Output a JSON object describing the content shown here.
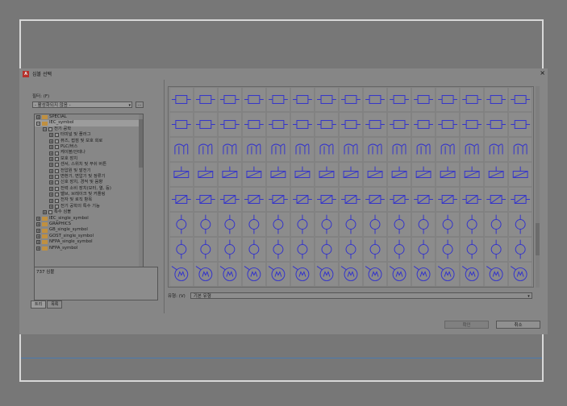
{
  "dialog": {
    "title": "심볼 선택",
    "close_glyph": "×",
    "app_icon_glyph": "A"
  },
  "filter": {
    "label": "필터: (F)",
    "value": "- 활성화되지 않음 -",
    "arrow": "▾",
    "more": "..."
  },
  "tree": {
    "items": [
      {
        "label": "SPECIAL",
        "depth": 0,
        "expander": "+",
        "kind": "folder"
      },
      {
        "label": "IEC_symbol",
        "depth": 0,
        "expander": "−",
        "kind": "folder",
        "selected": true
      },
      {
        "label": "전기 공학",
        "depth": 1,
        "expander": "−",
        "kind": "node"
      },
      {
        "label": "터미널 및 플러그",
        "depth": 2,
        "expander": "+",
        "kind": "node"
      },
      {
        "label": "퓨즈, 접점 및 보호 회로",
        "depth": 2,
        "expander": "+",
        "kind": "node"
      },
      {
        "label": "PLC/버스",
        "depth": 2,
        "expander": "+",
        "kind": "node"
      },
      {
        "label": "케이블/안테나",
        "depth": 2,
        "expander": "+",
        "kind": "node"
      },
      {
        "label": "보호 장치",
        "depth": 2,
        "expander": "+",
        "kind": "node"
      },
      {
        "label": "센서, 스위치 및 푸쉬 버튼",
        "depth": 2,
        "expander": "+",
        "kind": "node"
      },
      {
        "label": "전압원 및 발전기",
        "depth": 2,
        "expander": "+",
        "kind": "node"
      },
      {
        "label": "변환기, 변압기 및 정류기",
        "depth": 2,
        "expander": "+",
        "kind": "node"
      },
      {
        "label": "신호 장치, 경적 및 음향",
        "depth": 2,
        "expander": "+",
        "kind": "node"
      },
      {
        "label": "전력 소비 장치(모터, 열, 등)",
        "depth": 2,
        "expander": "+",
        "kind": "node"
      },
      {
        "label": "밸브, 브레이크 및 커플링",
        "depth": 2,
        "expander": "+",
        "kind": "node"
      },
      {
        "label": "전자 및 로직 항목",
        "depth": 2,
        "expander": "+",
        "kind": "node"
      },
      {
        "label": "전기 공학의 특수 기능",
        "depth": 2,
        "expander": "+",
        "kind": "node"
      },
      {
        "label": "특수 심볼",
        "depth": 1,
        "expander": "+",
        "kind": "node"
      },
      {
        "label": "IEC_single_symbol",
        "depth": 0,
        "expander": "+",
        "kind": "folder"
      },
      {
        "label": "GRAPHICS",
        "depth": 0,
        "expander": "+",
        "kind": "folder"
      },
      {
        "label": "GB_single_symbol",
        "depth": 0,
        "expander": "+",
        "kind": "folder"
      },
      {
        "label": "GOST_single_symbol",
        "depth": 0,
        "expander": "+",
        "kind": "folder"
      },
      {
        "label": "NFPA_single_symbol",
        "depth": 0,
        "expander": "+",
        "kind": "folder"
      },
      {
        "label": "NFPA_symbol",
        "depth": 0,
        "expander": "+",
        "kind": "folder"
      }
    ]
  },
  "status": {
    "count": "737 심볼"
  },
  "tabs": [
    {
      "label": "트리",
      "active": true
    },
    {
      "label": "목록",
      "active": false
    }
  ],
  "symbols": {
    "rows": 8,
    "cols": 15,
    "line_color": "#3333cc",
    "row_kinds": [
      "plug",
      "plug",
      "coil",
      "bar",
      "box",
      "circle",
      "circle",
      "motor"
    ]
  },
  "type_filter": {
    "label": "유형: (V)",
    "value": "기본 유형",
    "arrow": "▾"
  },
  "buttons": {
    "ok": "확인",
    "cancel": "취소"
  }
}
